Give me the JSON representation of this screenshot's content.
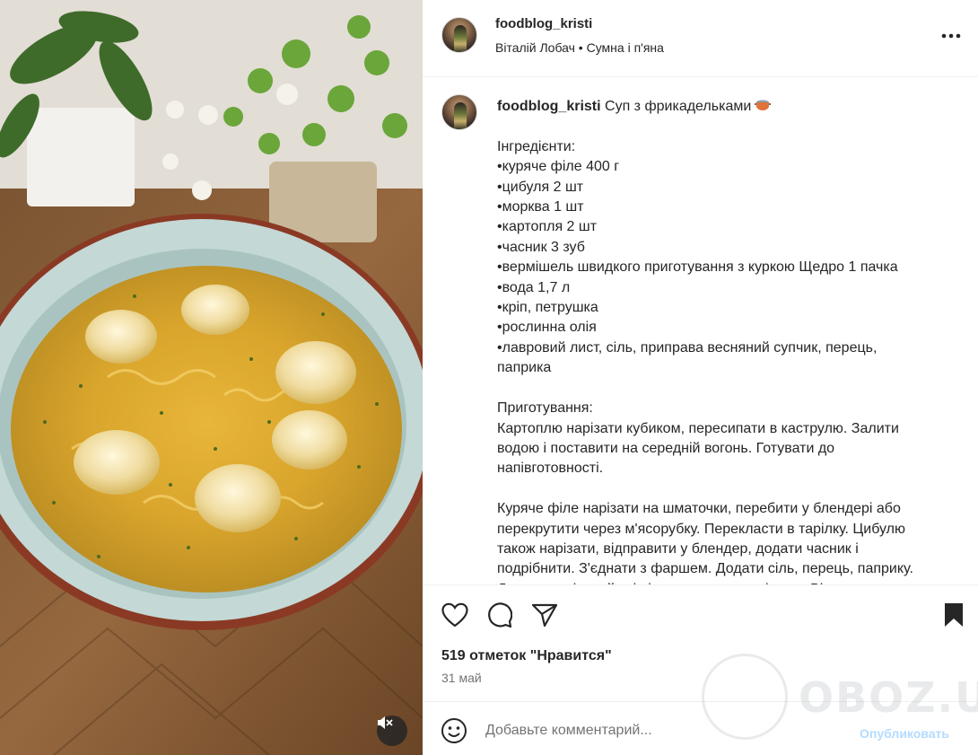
{
  "post": {
    "username": "foodblog_kristi",
    "audio_line": "Віталій Лобач • Сумна і п'яна",
    "caption_title": "Суп з фрикадельками",
    "caption_body": "\n\nІнгредієнти:\n•куряче філе 400 г\n•цибуля 2 шт\n•морква 1 шт\n•картопля 2 шт\n•часник 3 зуб\n•вермішель швидкого приготування з куркою Щедро 1 пачка\n•вода 1,7 л\n•кріп, петрушка\n•рослинна олія\n•лавровий лист, сіль, приправа весняний супчик, перець,\nпаприка\n\nПриготування:\nКартоплю нарізати кубиком, пересипати в каструлю. Залити\nводою і поставити на середній вогонь. Готувати до\nнапівготовності.\n\nКуряче філе нарізати на шматочки, перебити у блендері або\nперекрутити через м'ясорубку. Перекласти в тарілку. Цибулю\nтакож нарізати, відправити у блендер, додати часник і\nподрібнити. З'єднати з фаршем. Додати сіль, перець, паприку.\nДодати нарізаний кріп і петрушку, перемішати. Ві...",
    "likes": "519 отметок \"Нравится\"",
    "date": "31 май"
  },
  "comment": {
    "placeholder": "Добавьте комментарий...",
    "publish_label": "Опубликовать"
  },
  "watermark": {
    "text": "OBOZ.UA"
  },
  "icons": {
    "more": "more-options-icon",
    "like": "heart-icon",
    "comment": "comment-bubble-icon",
    "share": "paper-plane-icon",
    "save": "bookmark-icon",
    "emoji": "smiley-face-icon",
    "mute": "speaker-muted-icon"
  },
  "colors": {
    "text": "#262626",
    "secondary": "#737373",
    "publish_disabled": "#b3dbff",
    "divider": "#efefef"
  }
}
